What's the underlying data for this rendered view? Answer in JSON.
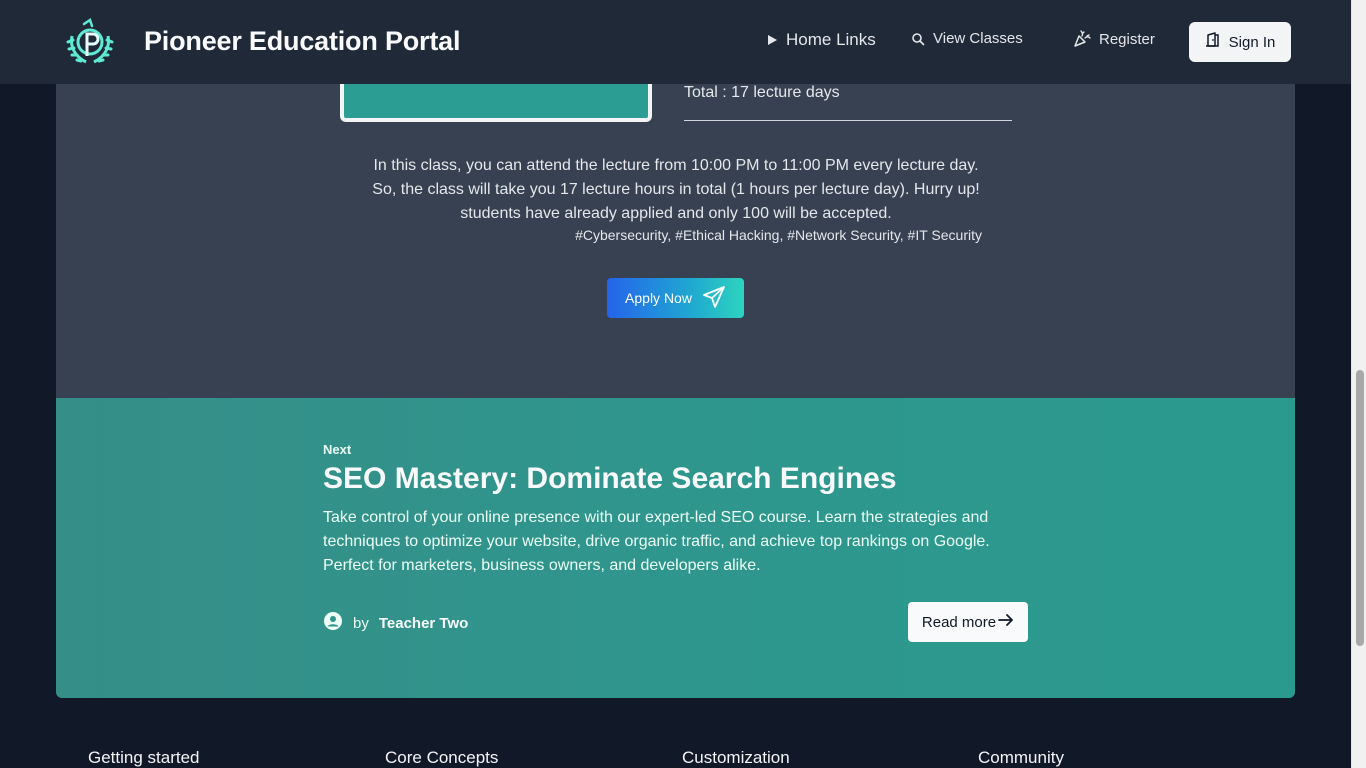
{
  "header": {
    "brand": "Pioneer Education Portal",
    "nav": {
      "home": "Home Links",
      "classes": "View Classes",
      "register": "Register",
      "signin": "Sign In"
    }
  },
  "class_detail": {
    "total": "Total : 17 lecture days",
    "description": "In this class, you can attend the lecture from 10:00 PM to 11:00 PM every lecture day. So, the class will take you 17 lecture hours in total (1 hours per lecture day). Hurry up! students have already applied and only 100 will be accepted.",
    "tags": "#Cybersecurity, #Ethical Hacking, #Network Security, #IT Security",
    "apply_label": "Apply Now"
  },
  "next_class": {
    "eyebrow": "Next",
    "title": "SEO Mastery: Dominate Search Engines",
    "description": "Take control of your online presence with our expert-led SEO course. Learn the strategies and techniques to optimize your website, drive organic traffic, and achieve top rankings on Google. Perfect for marketers, business owners, and developers alike.",
    "author_prefix": "by",
    "author_name": "Teacher Two",
    "read_more": "Read more"
  },
  "footer": {
    "columns": [
      "Getting started",
      "Core Concepts",
      "Customization",
      "Community"
    ]
  },
  "colors": {
    "header_bg": "#1f2937",
    "page_bg": "#111827",
    "detail_bg": "#374151",
    "teal": "#2c9d93",
    "apply_gradient_start": "#2563eb",
    "apply_gradient_end": "#2dd4bf"
  }
}
